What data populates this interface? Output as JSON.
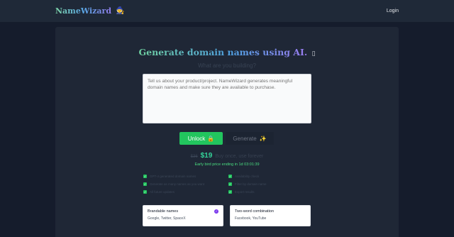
{
  "header": {
    "brand": "NameWizard",
    "brand_icon": "🧙",
    "login_label": "Login"
  },
  "hero": {
    "headline": "Generate domain names using AI.",
    "headline_icon": "▯",
    "subheading": "What are you building?"
  },
  "input": {
    "placeholder": "Tell us about your product/project. NameWizard generates meaningful domain names and make sure they are available to purchase."
  },
  "actions": {
    "unlock_label": "Unlock",
    "unlock_icon": "🔒",
    "generate_label": "Generate",
    "generate_icon": "✨"
  },
  "pricing": {
    "old_price": "$36",
    "price": "$19",
    "tagline": "Buy once, use forever",
    "early_bird": "Early bird price ending in 1d 03:01:39"
  },
  "features": [
    "GPT-4 generated domain names",
    "Generate as many names as you want",
    "All future updates",
    "Availability check",
    "Filter by domain name",
    "Export results"
  ],
  "options": [
    {
      "title": "Brandable names",
      "examples": "Google, Twitter, SpaceX",
      "selected": true
    },
    {
      "title": "Two-word combination",
      "examples": "Facebook, YouTube",
      "selected": false
    }
  ],
  "colors": {
    "page_bg": "#151c2c",
    "panel_bg": "#1f2736",
    "accent_green": "#22c55e",
    "accent_purple": "#7c3aed"
  }
}
